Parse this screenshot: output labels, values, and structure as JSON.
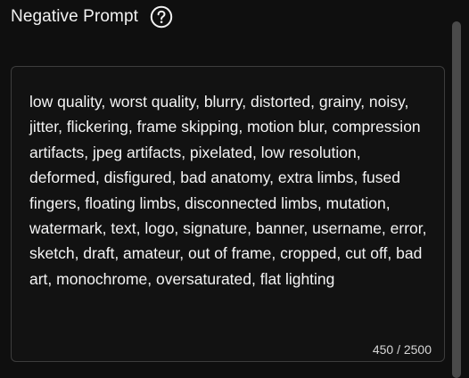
{
  "field": {
    "title": "Negative Prompt",
    "help_icon": "question-circle-icon",
    "value": "low quality, worst quality, blurry, distorted, grainy, noisy, jitter, flickering, frame skipping, motion blur, compression artifacts, jpeg artifacts, pixelated, low resolution, deformed, disfigured, bad anatomy, extra limbs, fused fingers, floating limbs, disconnected limbs, mutation, watermark, text, logo, signature, banner, username, error, sketch, draft, amateur, out of frame, cropped, cut off, bad art, monochrome, oversaturated, flat lighting",
    "char_count": "450 / 2500"
  }
}
